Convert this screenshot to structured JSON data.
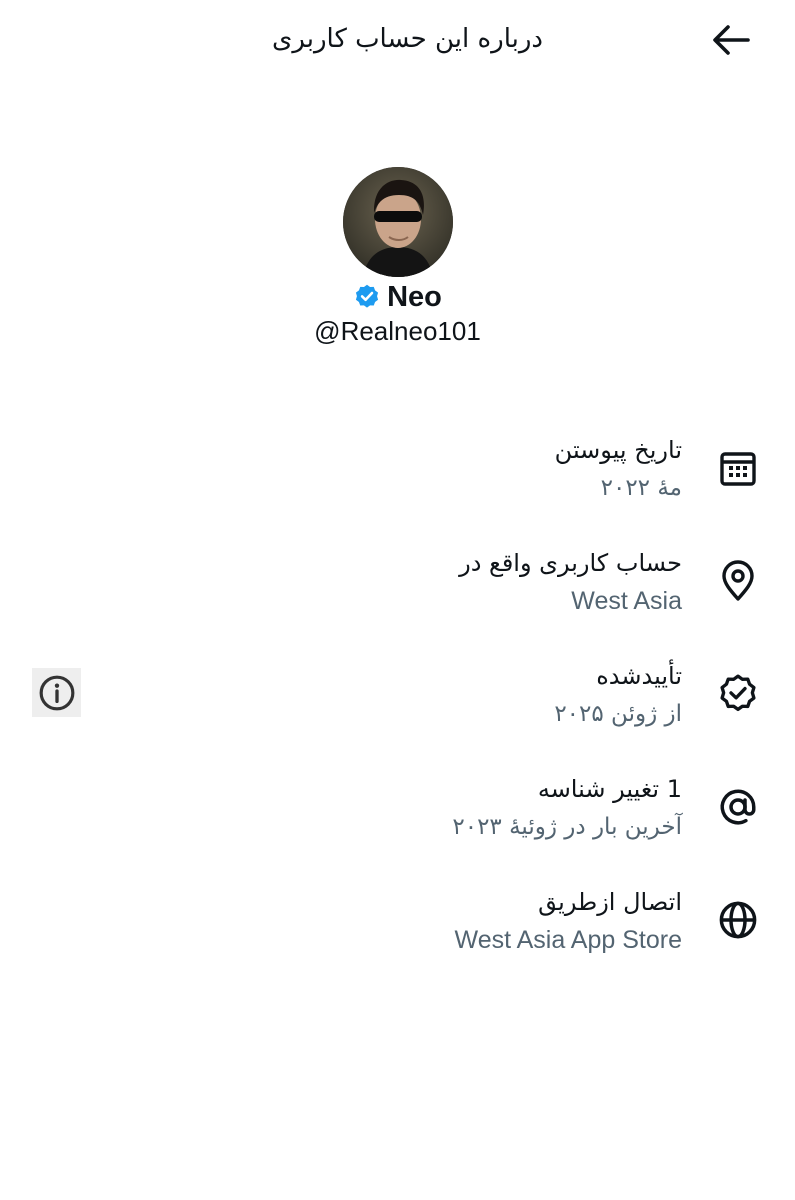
{
  "header": {
    "title": "درباره این حساب کاربری",
    "back_icon": "arrow-left-icon"
  },
  "profile": {
    "name": "Neo",
    "handle": "@Realneo101",
    "verified_icon": "verified-badge-icon",
    "verified_color": "#1d9bf0"
  },
  "details": [
    {
      "icon": "calendar-icon",
      "title": "تاریخ پیوستن",
      "subtitle": "مهٔ ۲۰۲۲"
    },
    {
      "icon": "location-pin-icon",
      "title": "حساب کاربری واقع در",
      "subtitle": "West Asia"
    },
    {
      "icon": "verified-outline-icon",
      "title": "تأییدشده",
      "subtitle": "از ژوئن ۲۰۲۵"
    },
    {
      "icon": "at-sign-icon",
      "title": "1 تغییر شناسه",
      "subtitle": "آخرین بار در ژوئیهٔ ۲۰۲۳"
    },
    {
      "icon": "globe-icon",
      "title": "اتصال ازطریق",
      "subtitle": "West Asia App Store"
    }
  ],
  "info_icon": "info-icon",
  "colors": {
    "text_primary": "#0f1419",
    "text_secondary": "#536471",
    "accent": "#1d9bf0"
  }
}
